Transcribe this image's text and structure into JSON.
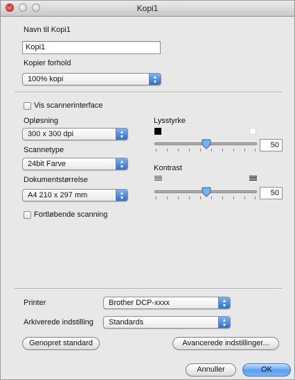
{
  "window": {
    "title": "Kopi1"
  },
  "name_section": {
    "label": "Navn til Kopi1",
    "value": "Kopi1"
  },
  "copy_ratio": {
    "label": "Kopier forhold",
    "selected": "100% kopi"
  },
  "scanner_ui_checkbox": {
    "label": "Vis scannerinterface",
    "checked": false
  },
  "resolution": {
    "label": "Opløsning",
    "selected": "300 x 300 dpi"
  },
  "scan_type": {
    "label": "Scannetype",
    "selected": "24bit Farve"
  },
  "document_size": {
    "label": "Dokumentstørrelse",
    "selected": "A4 210 x 297 mm"
  },
  "continuous_scan_checkbox": {
    "label": "Fortløbende scanning",
    "checked": false
  },
  "brightness": {
    "label": "Lysstyrke",
    "value": "50"
  },
  "contrast": {
    "label": "Kontrast",
    "value": "50"
  },
  "printer": {
    "label": "Printer",
    "selected": "Brother DCP-xxxx"
  },
  "saved_settings": {
    "label": "Arkiverede indstilling",
    "selected": "Standards"
  },
  "buttons": {
    "restore_default": "Genopret standard",
    "advanced": "Avancerede indstillinger...",
    "cancel": "Annuller",
    "ok": "OK"
  },
  "colors": {
    "accent": "#3a7fe0",
    "window_bg": "#e8e8e8"
  },
  "icons": {
    "dropdown": "up-down-arrows-icon",
    "brightness_low": "black-square-icon",
    "brightness_high": "white-square-icon",
    "contrast_low": "low-contrast-icon",
    "contrast_high": "high-contrast-icon"
  }
}
